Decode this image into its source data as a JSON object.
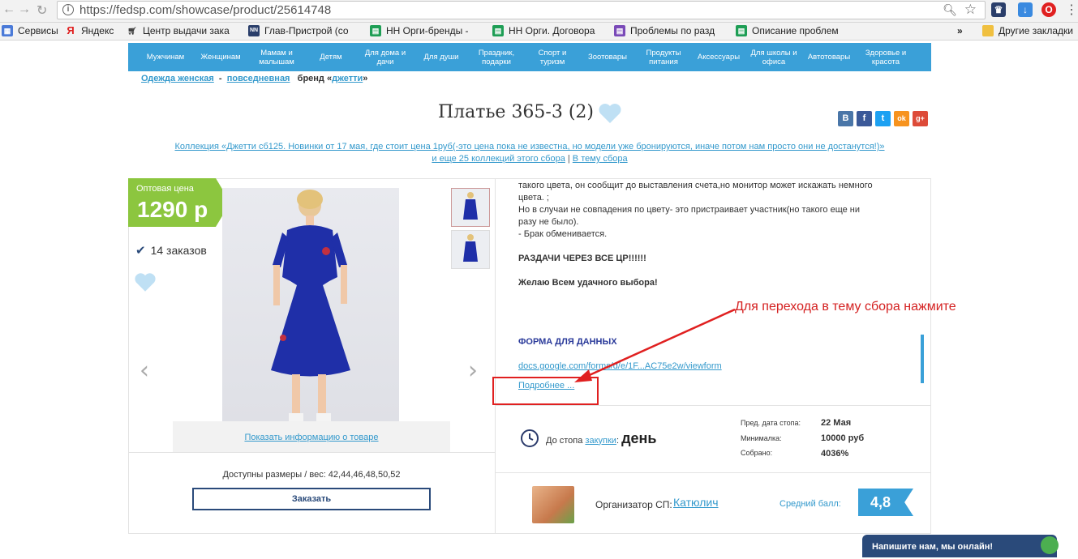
{
  "browser": {
    "url": "https://fedsp.com/showcase/product/25614748",
    "bookmarks": [
      "Сервисы",
      "Яндекс",
      "Центр выдачи зака",
      "Глав-Пристрой (со",
      "НН Орги-бренды -",
      "НН Орги. Договора",
      "Проблемы по разд",
      "Описание проблем"
    ],
    "more_bookmarks": "»",
    "other_bookmarks": "Другие закладки"
  },
  "nav": [
    "Мужчинам",
    "Женщинам",
    "Мамам и малышам",
    "Детям",
    "Для дома и дачи",
    "Для души",
    "Праздник, подарки",
    "Спорт и туризм",
    "Зоотовары",
    "Продукты питания",
    "Аксессуары",
    "Для школы и офиса",
    "Автотовары",
    "Здоровье и красота"
  ],
  "breadcrumb": {
    "cat1": "Одежда женская",
    "sep": "-",
    "cat2": "повседневная",
    "brand_prefix": "бренд «",
    "brand": "джетти",
    "brand_suffix": "»"
  },
  "product": {
    "title": "Платье 365-3 (2)",
    "collection_line": "Коллекция «Джетти сб125. Новинки от 17 мая, где стоит цена 1руб(-это цена пока не известна, но модели уже бронируются, иначе потом нам просто они не достанутся!)»",
    "more_collections": "и еще 25 коллекций этого сбора",
    "divider": "|",
    "to_topic": "В тему сбора",
    "price_label": "Оптовая цена",
    "price": "1290 р",
    "orders": "14 заказов",
    "show_info": "Показать информацию о товаре",
    "sizes": "Доступны размеры / вес: 42,44,46,48,50,52",
    "order_button": "Заказать"
  },
  "social": [
    "В",
    "f",
    "t",
    "ok",
    "g+"
  ],
  "description": {
    "line1": "такого цвета, он сообщит до выставления счета,но монитор может искажать немного",
    "line2": "цвета. ;",
    "line3": "Но в случаи не совпадения по цвету- это пристраивает участник(но такого еще ни",
    "line4": "разу не было).",
    "line5": "- Брак обменивается.",
    "bold1": "РАЗДАЧИ ЧЕРЕЗ ВСЕ ЦР!!!!!!",
    "bold2": "Желаю Всем удачного выбора!",
    "form_title": "ФОРМА ДЛЯ ДАННЫХ",
    "form_link": "docs.google.com/forms/d/e/1F...AC75e2w/viewform",
    "more": "Подробнее ..."
  },
  "annotation": "Для перехода в тему сбора нажмите",
  "stop": {
    "label": "До стопа",
    "link": "закупки",
    "colon": ":",
    "value": "день"
  },
  "stats": {
    "date_label": "Пред. дата стопа:",
    "date_value": "22 Мая",
    "min_label": "Минималка:",
    "min_value": "10000 руб",
    "collected_label": "Собрано:",
    "collected_value": "4036%"
  },
  "organizer": {
    "label": "Организатор СП:",
    "name": "Катюлич",
    "avg_label": "Средний балл:",
    "rating": "4,8"
  },
  "chat": "Напишите нам, мы онлайн!",
  "colors": {
    "nav_bg": "#3aa0d8",
    "price_badge": "#8cc63f",
    "link": "#3399cc",
    "annotation": "#d42020",
    "chat": "#2a4a7a"
  }
}
